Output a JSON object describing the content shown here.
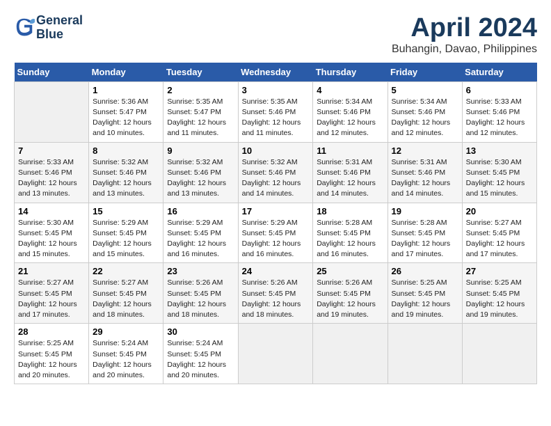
{
  "header": {
    "logo_line1": "General",
    "logo_line2": "Blue",
    "month_title": "April 2024",
    "location": "Buhangin, Davao, Philippines"
  },
  "days_of_week": [
    "Sunday",
    "Monday",
    "Tuesday",
    "Wednesday",
    "Thursday",
    "Friday",
    "Saturday"
  ],
  "weeks": [
    [
      {
        "day": "",
        "info": ""
      },
      {
        "day": "1",
        "info": "Sunrise: 5:36 AM\nSunset: 5:47 PM\nDaylight: 12 hours\nand 10 minutes."
      },
      {
        "day": "2",
        "info": "Sunrise: 5:35 AM\nSunset: 5:47 PM\nDaylight: 12 hours\nand 11 minutes."
      },
      {
        "day": "3",
        "info": "Sunrise: 5:35 AM\nSunset: 5:46 PM\nDaylight: 12 hours\nand 11 minutes."
      },
      {
        "day": "4",
        "info": "Sunrise: 5:34 AM\nSunset: 5:46 PM\nDaylight: 12 hours\nand 12 minutes."
      },
      {
        "day": "5",
        "info": "Sunrise: 5:34 AM\nSunset: 5:46 PM\nDaylight: 12 hours\nand 12 minutes."
      },
      {
        "day": "6",
        "info": "Sunrise: 5:33 AM\nSunset: 5:46 PM\nDaylight: 12 hours\nand 12 minutes."
      }
    ],
    [
      {
        "day": "7",
        "info": "Sunrise: 5:33 AM\nSunset: 5:46 PM\nDaylight: 12 hours\nand 13 minutes."
      },
      {
        "day": "8",
        "info": "Sunrise: 5:32 AM\nSunset: 5:46 PM\nDaylight: 12 hours\nand 13 minutes."
      },
      {
        "day": "9",
        "info": "Sunrise: 5:32 AM\nSunset: 5:46 PM\nDaylight: 12 hours\nand 13 minutes."
      },
      {
        "day": "10",
        "info": "Sunrise: 5:32 AM\nSunset: 5:46 PM\nDaylight: 12 hours\nand 14 minutes."
      },
      {
        "day": "11",
        "info": "Sunrise: 5:31 AM\nSunset: 5:46 PM\nDaylight: 12 hours\nand 14 minutes."
      },
      {
        "day": "12",
        "info": "Sunrise: 5:31 AM\nSunset: 5:46 PM\nDaylight: 12 hours\nand 14 minutes."
      },
      {
        "day": "13",
        "info": "Sunrise: 5:30 AM\nSunset: 5:45 PM\nDaylight: 12 hours\nand 15 minutes."
      }
    ],
    [
      {
        "day": "14",
        "info": "Sunrise: 5:30 AM\nSunset: 5:45 PM\nDaylight: 12 hours\nand 15 minutes."
      },
      {
        "day": "15",
        "info": "Sunrise: 5:29 AM\nSunset: 5:45 PM\nDaylight: 12 hours\nand 15 minutes."
      },
      {
        "day": "16",
        "info": "Sunrise: 5:29 AM\nSunset: 5:45 PM\nDaylight: 12 hours\nand 16 minutes."
      },
      {
        "day": "17",
        "info": "Sunrise: 5:29 AM\nSunset: 5:45 PM\nDaylight: 12 hours\nand 16 minutes."
      },
      {
        "day": "18",
        "info": "Sunrise: 5:28 AM\nSunset: 5:45 PM\nDaylight: 12 hours\nand 16 minutes."
      },
      {
        "day": "19",
        "info": "Sunrise: 5:28 AM\nSunset: 5:45 PM\nDaylight: 12 hours\nand 17 minutes."
      },
      {
        "day": "20",
        "info": "Sunrise: 5:27 AM\nSunset: 5:45 PM\nDaylight: 12 hours\nand 17 minutes."
      }
    ],
    [
      {
        "day": "21",
        "info": "Sunrise: 5:27 AM\nSunset: 5:45 PM\nDaylight: 12 hours\nand 17 minutes."
      },
      {
        "day": "22",
        "info": "Sunrise: 5:27 AM\nSunset: 5:45 PM\nDaylight: 12 hours\nand 18 minutes."
      },
      {
        "day": "23",
        "info": "Sunrise: 5:26 AM\nSunset: 5:45 PM\nDaylight: 12 hours\nand 18 minutes."
      },
      {
        "day": "24",
        "info": "Sunrise: 5:26 AM\nSunset: 5:45 PM\nDaylight: 12 hours\nand 18 minutes."
      },
      {
        "day": "25",
        "info": "Sunrise: 5:26 AM\nSunset: 5:45 PM\nDaylight: 12 hours\nand 19 minutes."
      },
      {
        "day": "26",
        "info": "Sunrise: 5:25 AM\nSunset: 5:45 PM\nDaylight: 12 hours\nand 19 minutes."
      },
      {
        "day": "27",
        "info": "Sunrise: 5:25 AM\nSunset: 5:45 PM\nDaylight: 12 hours\nand 19 minutes."
      }
    ],
    [
      {
        "day": "28",
        "info": "Sunrise: 5:25 AM\nSunset: 5:45 PM\nDaylight: 12 hours\nand 20 minutes."
      },
      {
        "day": "29",
        "info": "Sunrise: 5:24 AM\nSunset: 5:45 PM\nDaylight: 12 hours\nand 20 minutes."
      },
      {
        "day": "30",
        "info": "Sunrise: 5:24 AM\nSunset: 5:45 PM\nDaylight: 12 hours\nand 20 minutes."
      },
      {
        "day": "",
        "info": ""
      },
      {
        "day": "",
        "info": ""
      },
      {
        "day": "",
        "info": ""
      },
      {
        "day": "",
        "info": ""
      }
    ]
  ]
}
